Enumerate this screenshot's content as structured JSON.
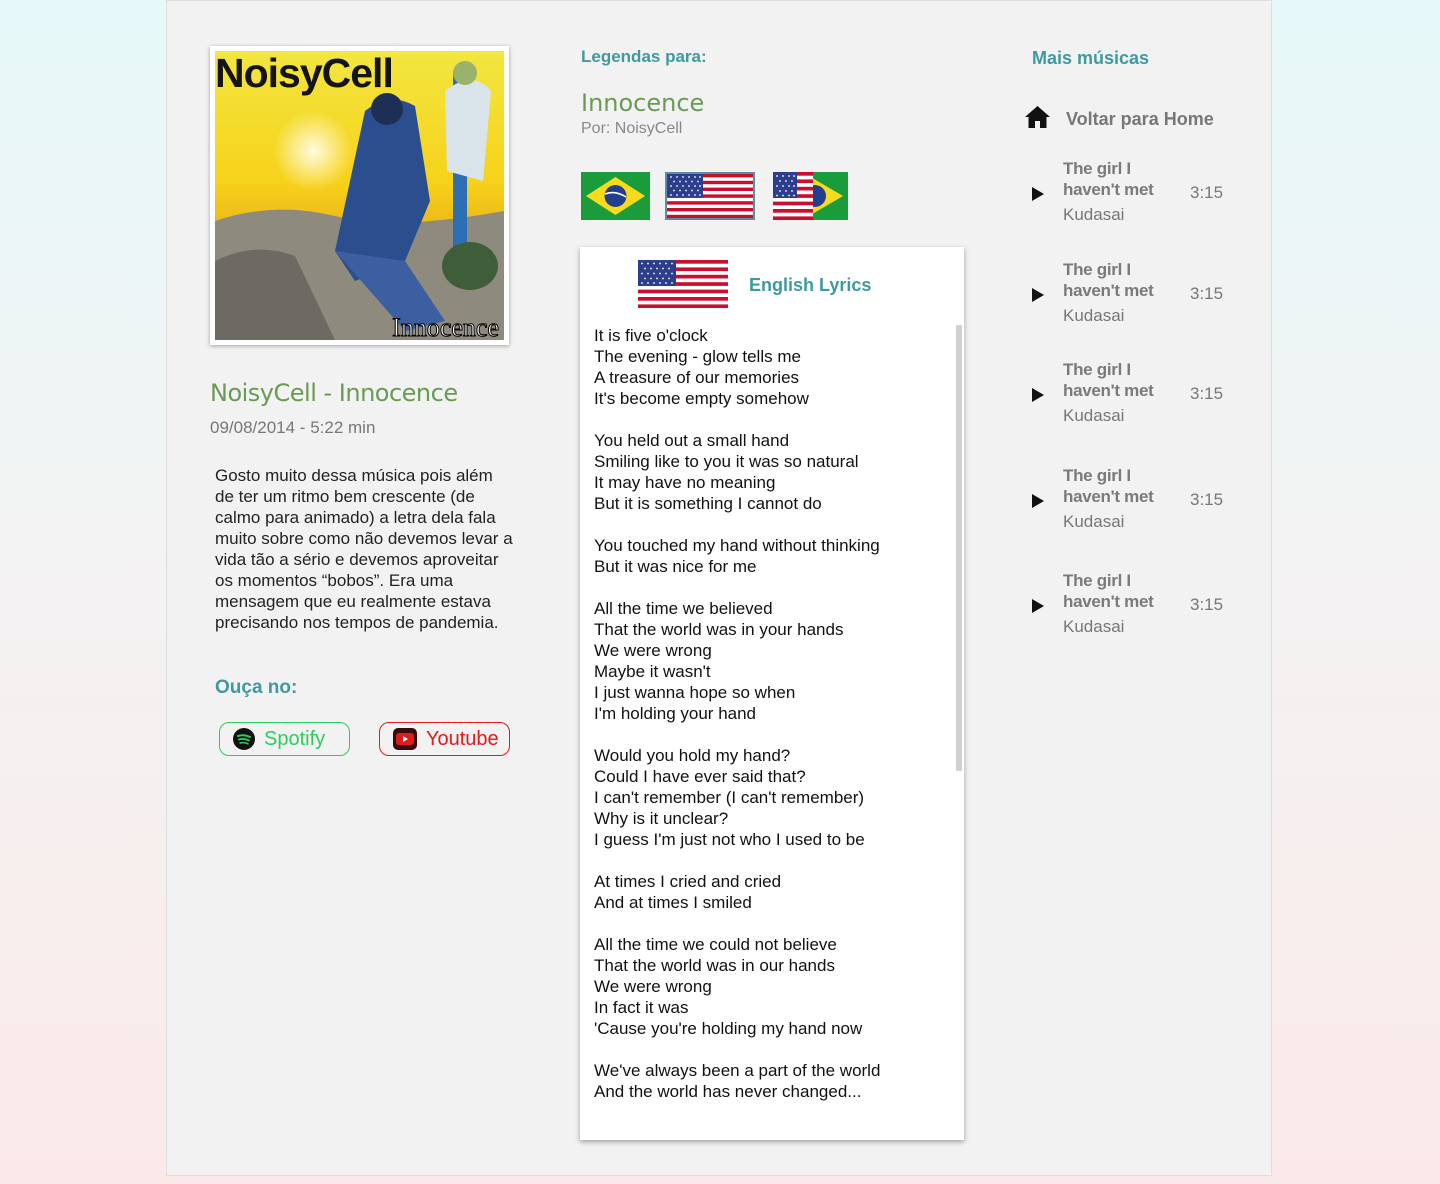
{
  "song": {
    "cover_brand": "NoisyCell",
    "cover_caption": "Innocence",
    "title": "NoisyCell - Innocence",
    "meta": "09/08/2014 - 5:22 min",
    "description": "Gosto muito dessa música pois além de ter um ritmo bem crescente (de calmo para animado) a letra dela fala muito sobre como não devemos levar a vida tão a sério e devemos aproveitar os momentos “bobos”. Era uma mensagem que eu realmente estava precisando nos tempos de pandemia.",
    "listen_label": "Ouça no:",
    "spotify_label": "Spotify",
    "youtube_label": "Youtube"
  },
  "subtitles": {
    "label": "Legendas para:",
    "title": "Innocence",
    "by": "Por: NoisyCell",
    "flags": [
      "brazil-flag",
      "usa-flag",
      "usa-brazil-flag"
    ],
    "active": "usa-flag"
  },
  "lyrics": {
    "label": "English Lyrics",
    "text": "It is five o'clock\nThe evening - glow tells me\nA treasure of our memories\nIt's become empty somehow\n\nYou held out a small hand\nSmiling like to you it was so natural\nIt may have no meaning\nBut it is something I cannot do\n\nYou touched my hand without thinking\nBut it was nice for me\n\nAll the time we believed\nThat the world was in your hands\nWe were wrong\nMaybe it wasn't\nI just wanna hope so when\nI'm holding your hand\n\nWould you hold my hand?\nCould I have ever said that?\nI can't remember (I can't remember)\nWhy is it unclear?\nI guess I'm just not who I used to be\n\nAt times I cried and cried\nAnd at times I smiled\n\nAll the time we could not believe\nThat the world was in our hands\nWe were wrong\nIn fact it was\n'Cause you're holding my hand now\n\nWe've always been a part of the world\nAnd the world has never changed..."
  },
  "sidebar": {
    "label": "Mais músicas",
    "home_label": "Voltar para Home",
    "tracks": [
      {
        "title": "The girl I haven't met",
        "artist": "Kudasai",
        "duration": "3:15"
      },
      {
        "title": "The girl I haven't met",
        "artist": "Kudasai",
        "duration": "3:15"
      },
      {
        "title": "The girl I haven't met",
        "artist": "Kudasai",
        "duration": "3:15"
      },
      {
        "title": "The girl I haven't met",
        "artist": "Kudasai",
        "duration": "3:15"
      },
      {
        "title": "The girl I haven't met",
        "artist": "Kudasai",
        "duration": "3:15"
      }
    ]
  },
  "colors": {
    "accent_teal": "#3f9a9f",
    "accent_green": "#6a9a55",
    "spotify": "#2ecc5e",
    "youtube": "#e01b1b"
  }
}
